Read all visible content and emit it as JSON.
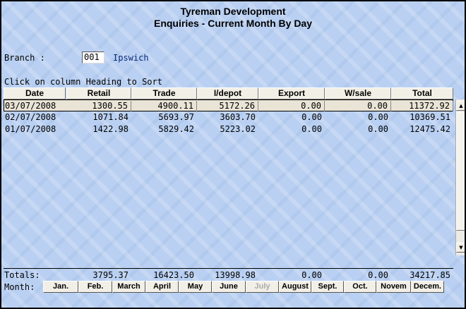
{
  "header": {
    "title": "Tyreman Development",
    "subtitle": "Enquiries - Current Month By Day"
  },
  "branch": {
    "label": "Branch :",
    "code": "001",
    "name": "Ipswich"
  },
  "hint": "Click on column Heading to Sort",
  "columns": [
    "Date",
    "Retail",
    "Trade",
    "I/depot",
    "Export",
    "W/sale",
    "Total"
  ],
  "rows": [
    {
      "date": "03/07/2008",
      "retail": "1300.55",
      "trade": "4900.11",
      "idepot": "5172.26",
      "export": "0.00",
      "wsale": "0.00",
      "total": "11372.92",
      "selected": true
    },
    {
      "date": "02/07/2008",
      "retail": "1071.84",
      "trade": "5693.97",
      "idepot": "3603.70",
      "export": "0.00",
      "wsale": "0.00",
      "total": "10369.51",
      "selected": false
    },
    {
      "date": "01/07/2008",
      "retail": "1422.98",
      "trade": "5829.42",
      "idepot": "5223.02",
      "export": "0.00",
      "wsale": "0.00",
      "total": "12475.42",
      "selected": false
    }
  ],
  "totals": {
    "label": "Totals:",
    "retail": "3795.37",
    "trade": "16423.50",
    "idepot": "13998.98",
    "export": "0.00",
    "wsale": "0.00",
    "total": "34217.85"
  },
  "months": {
    "label": "Month:",
    "buttons": [
      {
        "label": "Jan.",
        "enabled": true
      },
      {
        "label": "Feb.",
        "enabled": true
      },
      {
        "label": "March",
        "enabled": true
      },
      {
        "label": "April",
        "enabled": true
      },
      {
        "label": "May",
        "enabled": true
      },
      {
        "label": "June",
        "enabled": true
      },
      {
        "label": "July",
        "enabled": false
      },
      {
        "label": "August",
        "enabled": true
      },
      {
        "label": "Sept.",
        "enabled": true
      },
      {
        "label": "Oct.",
        "enabled": true
      },
      {
        "label": "Novem",
        "enabled": true
      },
      {
        "label": "Decem.",
        "enabled": true
      }
    ]
  },
  "scrollbar": {
    "up_icon": "triangle-up-icon",
    "down_icon": "triangle-down-icon"
  }
}
